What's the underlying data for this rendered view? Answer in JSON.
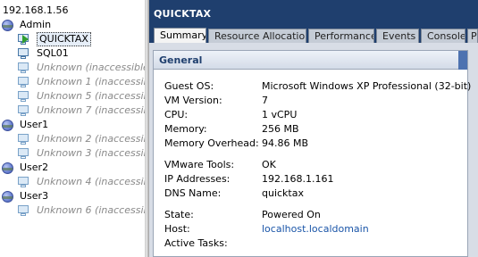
{
  "tree": {
    "host": "192.168.1.56",
    "items": [
      {
        "type": "pool",
        "label": "Admin"
      },
      {
        "type": "vm",
        "label": "QUICKTAX",
        "selected": true,
        "running": true
      },
      {
        "type": "vm",
        "label": "SQL01"
      },
      {
        "type": "vm",
        "label": "Unknown (inaccessible)",
        "dim": true
      },
      {
        "type": "vm",
        "label": "Unknown 1 (inaccessible",
        "dim": true
      },
      {
        "type": "vm",
        "label": "Unknown 5 (inaccessible",
        "dim": true
      },
      {
        "type": "vm",
        "label": "Unknown 7 (inaccessible",
        "dim": true
      },
      {
        "type": "pool",
        "label": "User1"
      },
      {
        "type": "vm",
        "label": "Unknown 2 (inaccessible",
        "dim": true
      },
      {
        "type": "vm",
        "label": "Unknown 3 (inaccessible",
        "dim": true
      },
      {
        "type": "pool",
        "label": "User2"
      },
      {
        "type": "vm",
        "label": "Unknown 4 (inaccessible",
        "dim": true
      },
      {
        "type": "pool",
        "label": "User3"
      },
      {
        "type": "vm",
        "label": "Unknown 6 (inaccessible",
        "dim": true
      }
    ]
  },
  "detail": {
    "title": "QUICKTAX",
    "tabs": [
      {
        "label": "Summary",
        "active": true
      },
      {
        "label": "Resource Allocation"
      },
      {
        "label": "Performance"
      },
      {
        "label": "Events"
      },
      {
        "label": "Console"
      },
      {
        "label": "P"
      }
    ],
    "section_title": "General",
    "fields": [
      {
        "label": "Guest OS:",
        "value": "Microsoft Windows XP Professional (32-bit)"
      },
      {
        "label": "VM Version:",
        "value": "7"
      },
      {
        "label": "CPU:",
        "value": "1 vCPU"
      },
      {
        "label": "Memory:",
        "value": "256 MB"
      },
      {
        "label": "Memory Overhead:",
        "value": "94.86 MB"
      },
      {
        "label": "VMware Tools:",
        "value": "OK"
      },
      {
        "label": "IP Addresses:",
        "value": "192.168.1.161"
      },
      {
        "label": "DNS Name:",
        "value": "quicktax"
      },
      {
        "label": "State:",
        "value": "Powered On"
      },
      {
        "label": "Host:",
        "value": "localhost.localdomain",
        "link": true
      },
      {
        "label": "Active Tasks:",
        "value": ""
      }
    ]
  },
  "colors": {
    "title_bar": "#1f3f6e",
    "link": "#1a55a8",
    "dim_text": "#8a8a8a"
  }
}
